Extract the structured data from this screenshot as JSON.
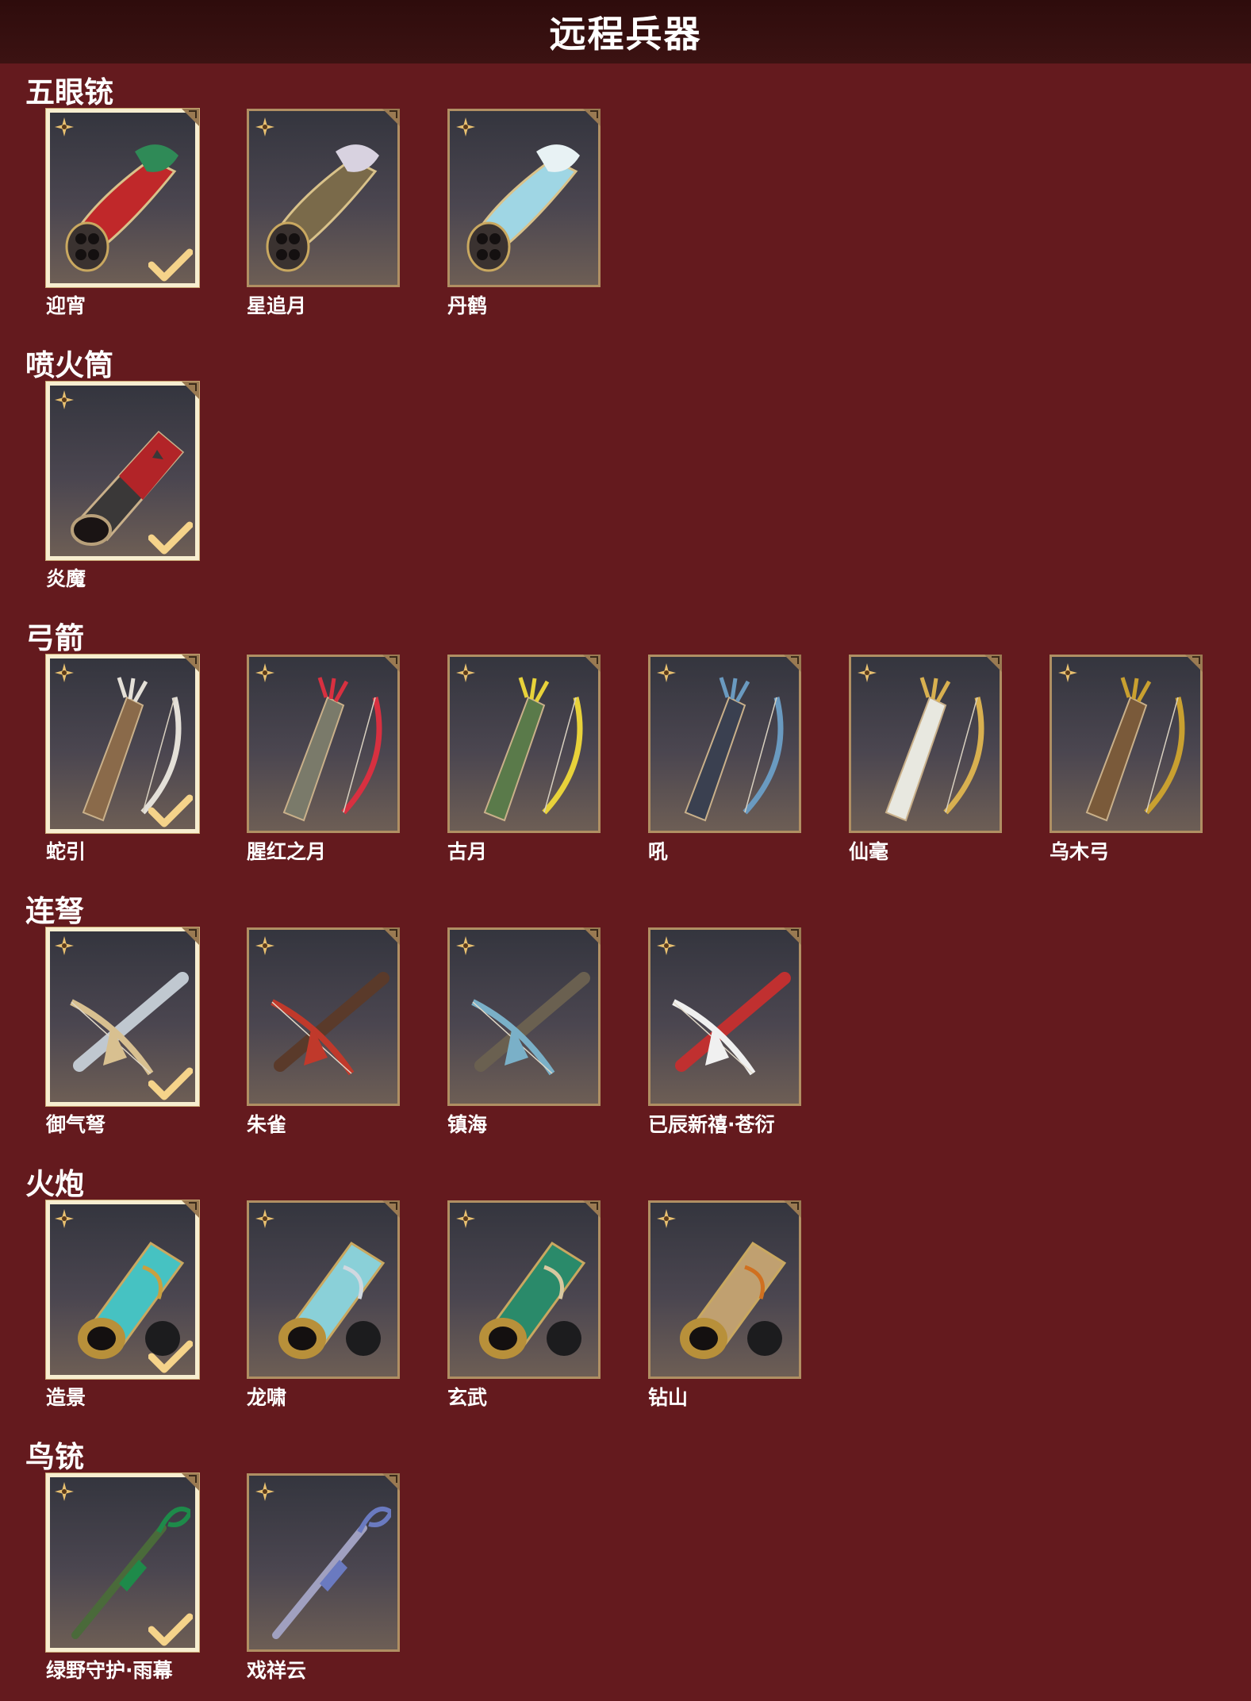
{
  "page": {
    "title": "远程兵器"
  },
  "categories": [
    {
      "title": "五眼铳",
      "items": [
        {
          "name": "迎宵",
          "equipped": true
        },
        {
          "name": "星追月",
          "equipped": false
        },
        {
          "name": "丹鹤",
          "equipped": false
        }
      ]
    },
    {
      "title": "喷火筒",
      "items": [
        {
          "name": "炎魔",
          "equipped": true
        }
      ]
    },
    {
      "title": "弓箭",
      "items": [
        {
          "name": "蛇引",
          "equipped": true
        },
        {
          "name": "腥红之月",
          "equipped": false
        },
        {
          "name": "古月",
          "equipped": false
        },
        {
          "name": "吼",
          "equipped": false
        },
        {
          "name": "仙毫",
          "equipped": false
        },
        {
          "name": "乌木弓",
          "equipped": false
        }
      ]
    },
    {
      "title": "连弩",
      "items": [
        {
          "name": "御气弩",
          "equipped": true
        },
        {
          "name": "朱雀",
          "equipped": false
        },
        {
          "name": "镇海",
          "equipped": false
        },
        {
          "name": "已辰新禧·苍衍",
          "equipped": false
        }
      ]
    },
    {
      "title": "火炮",
      "items": [
        {
          "name": "造景",
          "equipped": true
        },
        {
          "name": "龙啸",
          "equipped": false
        },
        {
          "name": "玄武",
          "equipped": false
        },
        {
          "name": "钻山",
          "equipped": false
        }
      ]
    },
    {
      "title": "鸟铳",
      "items": [
        {
          "name": "绿野守护·雨幕",
          "equipped": true
        },
        {
          "name": "戏祥云",
          "equipped": false
        }
      ]
    }
  ],
  "icons": {
    "rarity": "star-icon",
    "corner": "corner-tab-icon",
    "equipped": "check-icon"
  },
  "colors": {
    "background": "#641a1e",
    "header": "#2e0c0c",
    "card_border": "#b08f63",
    "equipped_border": "#f7eed0",
    "accent_gold": "#e8c070"
  }
}
